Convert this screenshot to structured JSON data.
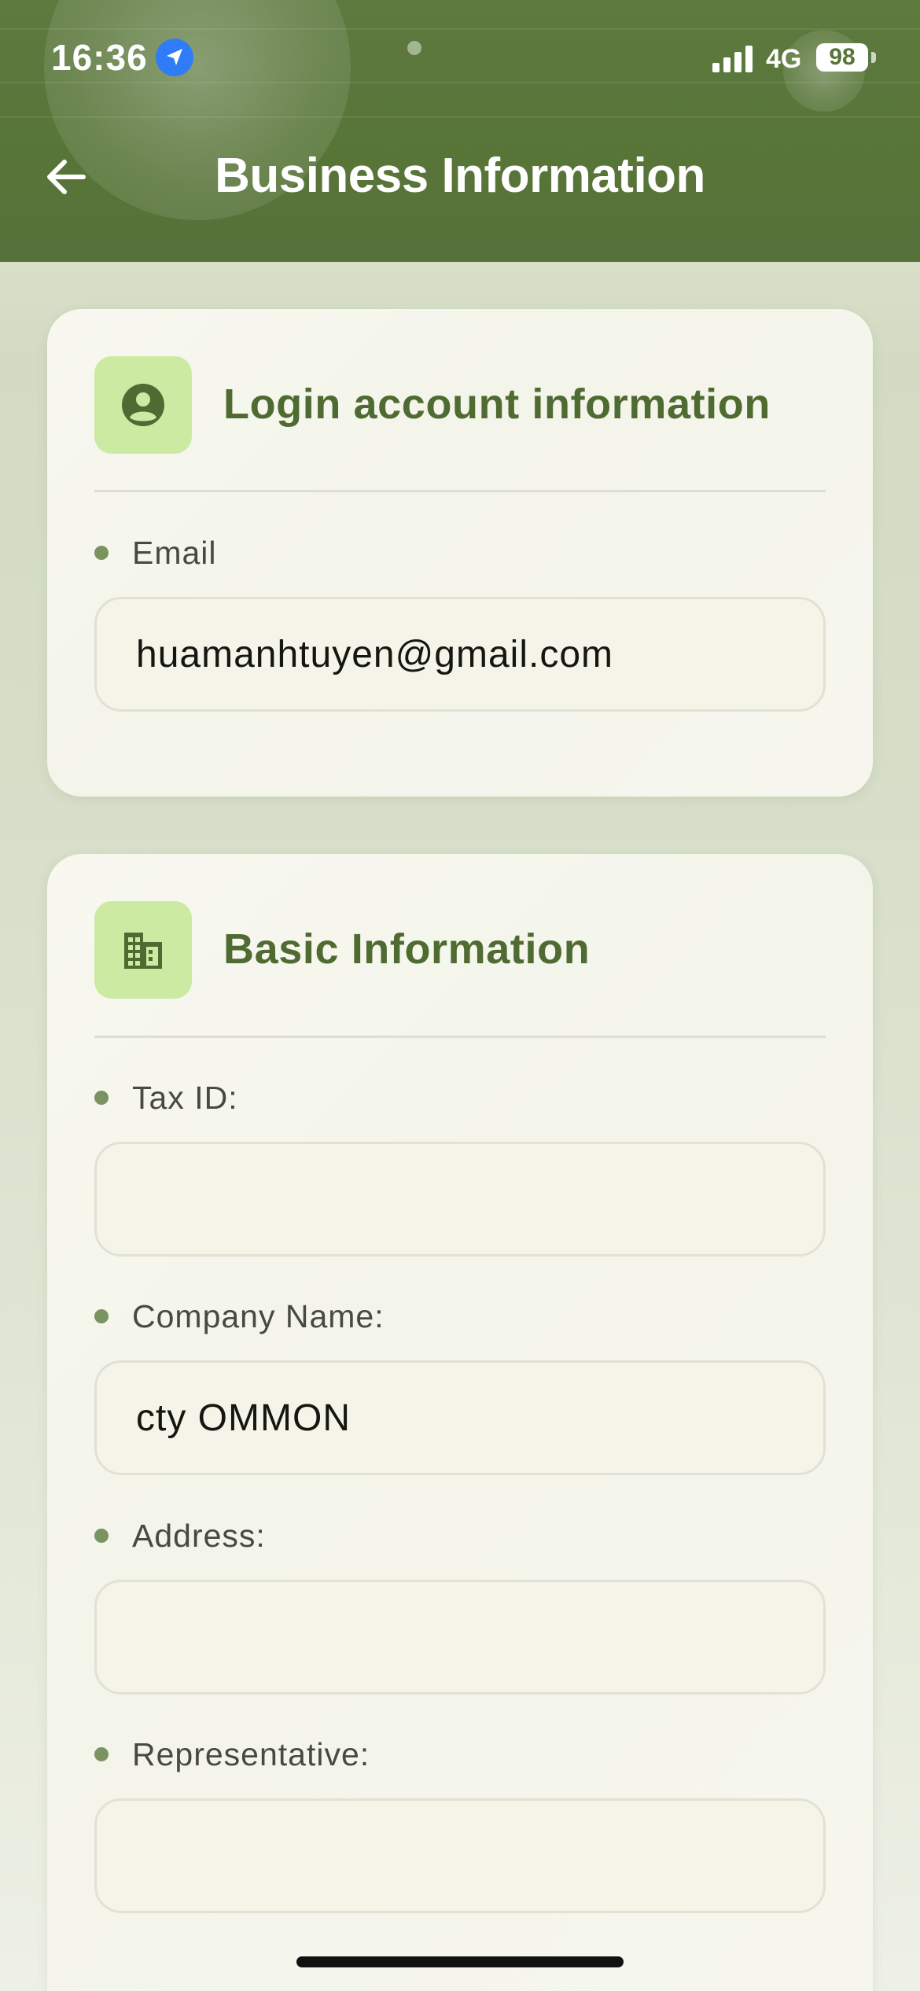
{
  "status_bar": {
    "time": "16:36",
    "network": "4G",
    "battery": "98",
    "icons": [
      "location-arrow-icon",
      "cellular-signal-icon",
      "battery-icon"
    ]
  },
  "header": {
    "title": "Business Information",
    "back_icon": "arrow-left-icon"
  },
  "login_section": {
    "icon": "account-circle-icon",
    "title": "Login account information",
    "email_label": "Email",
    "email_value": "huamanhtuyen@gmail.com"
  },
  "basic_section": {
    "icon": "building-icon",
    "title": "Basic Information",
    "tax_id_label": "Tax ID:",
    "tax_id_value": "",
    "company_label": "Company Name:",
    "company_value": "cty OMMON",
    "address_label": "Address:",
    "address_value": "",
    "representative_label": "Representative:",
    "representative_value": ""
  },
  "colors": {
    "header_bg": "#587538",
    "accent_text": "#4f6b31",
    "icon_tile": "#cdeaa3",
    "bullet": "#7a9361",
    "location_blue": "#2f7cf6"
  }
}
